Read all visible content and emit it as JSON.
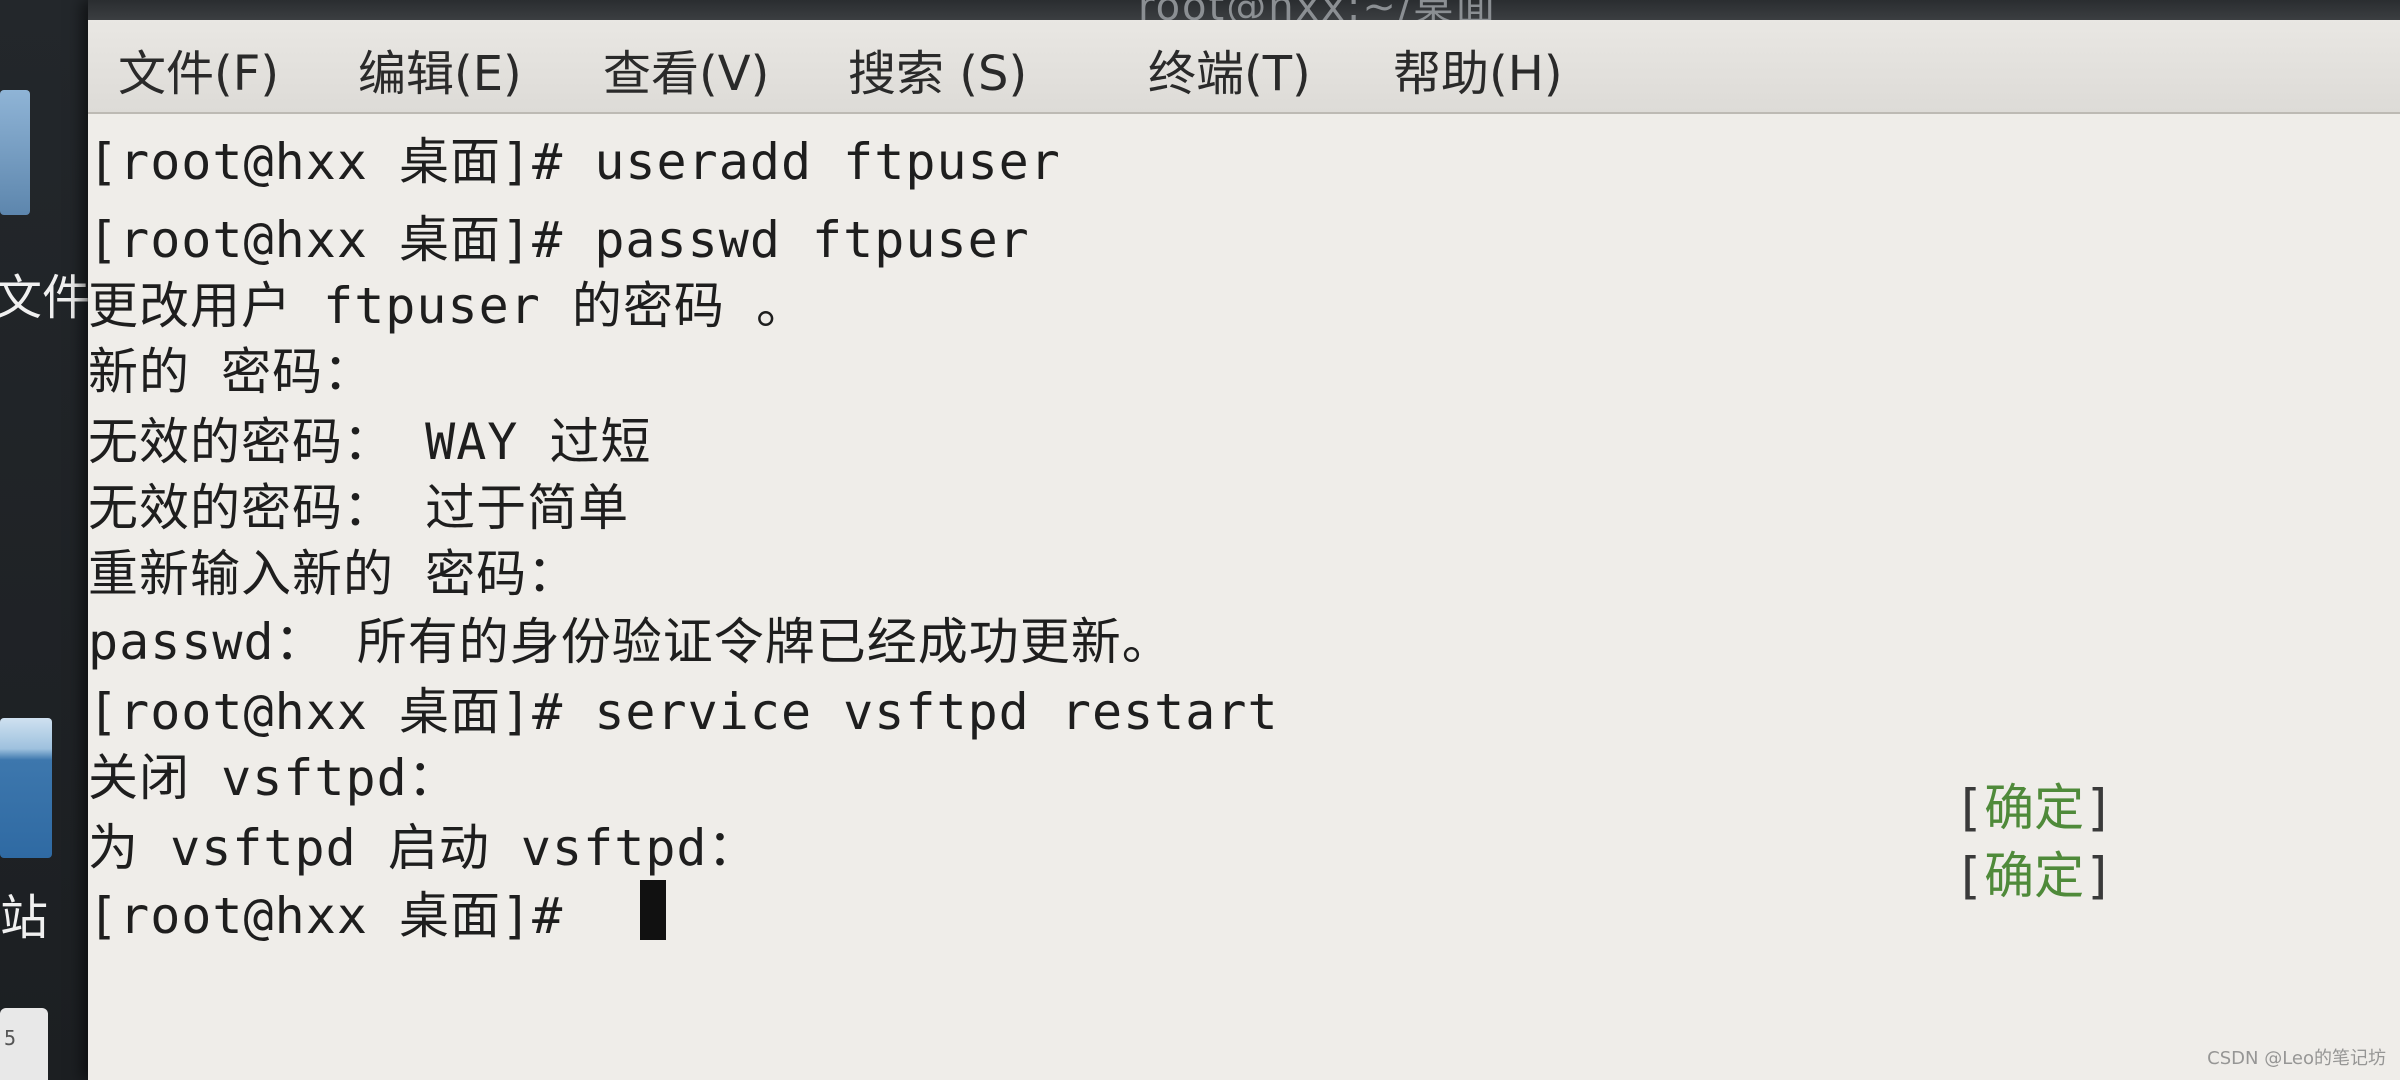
{
  "window": {
    "title": "root@hxx:~/桌面"
  },
  "menu": [
    {
      "label": "文件(F)"
    },
    {
      "label": "编辑(E)"
    },
    {
      "label": "查看(V)"
    },
    {
      "label": "搜索 (S)"
    },
    {
      "label": "终端(T)"
    },
    {
      "label": "帮助(H)"
    }
  ],
  "desktop": {
    "label_files": "文件",
    "label_trash": "站",
    "icon_small_text": "5"
  },
  "terminal": {
    "lines": [
      "[root@hxx 桌面]# useradd ftpuser",
      "[root@hxx 桌面]# passwd ftpuser",
      "更改用户 ftpuser 的密码 。",
      "新的 密码：",
      "无效的密码： WAY 过短",
      "无效的密码： 过于简单",
      "重新输入新的 密码：",
      "passwd： 所有的身份验证令牌已经成功更新。",
      "[root@hxx 桌面]# service vsftpd restart",
      "关闭 vsftpd：",
      "为 vsftpd 启动 vsftpd：",
      "[root@hxx 桌面]# "
    ],
    "status": [
      {
        "open": "[",
        "text": "确定",
        "close": "]"
      },
      {
        "open": "[",
        "text": "确定",
        "close": "]"
      }
    ]
  },
  "watermark": "CSDN @Leo的笔记坊",
  "colors": {
    "terminal_bg": "#efede9",
    "ok_green": "#4f8a3a",
    "text": "#1e1e1e"
  }
}
